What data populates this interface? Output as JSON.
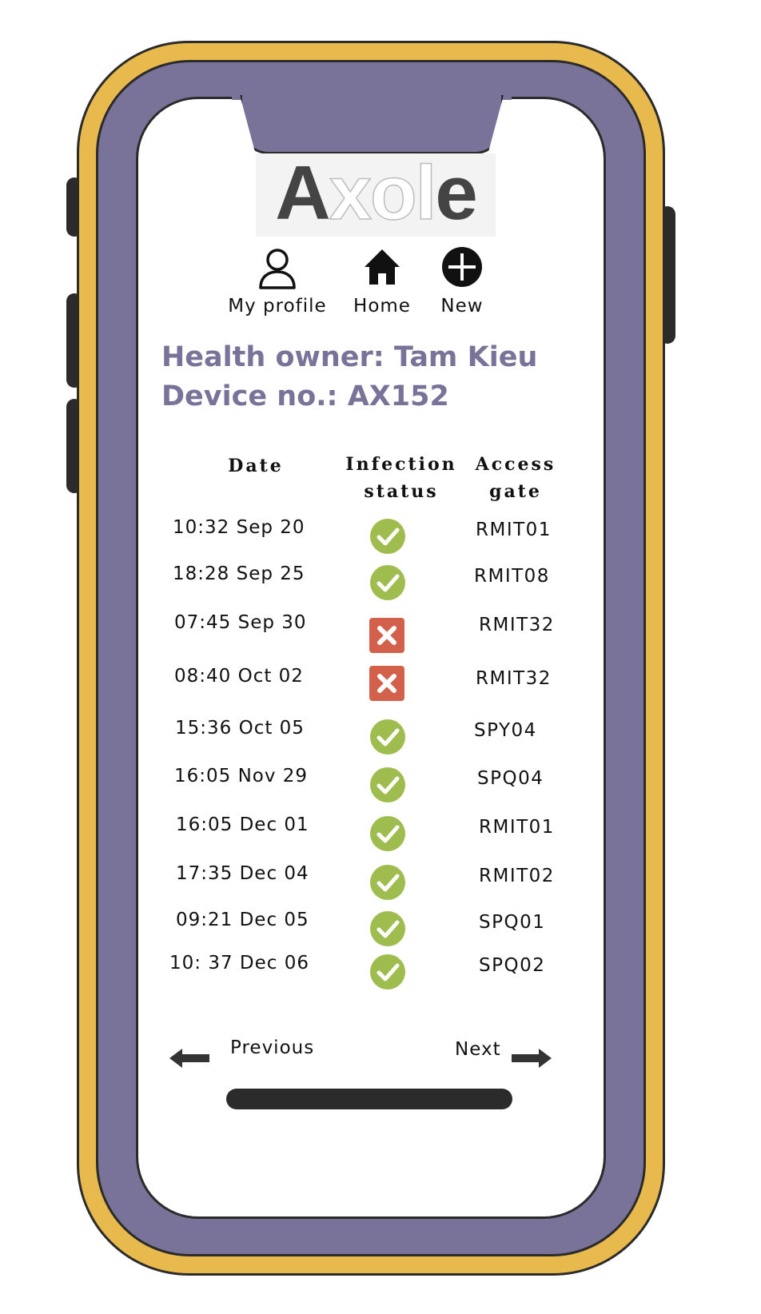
{
  "app": {
    "logo_solid_1": "A",
    "logo_hollow": "xol",
    "logo_solid_2": "e"
  },
  "nav": [
    {
      "label": "My profile",
      "icon": "user-icon"
    },
    {
      "label": "Home",
      "icon": "home-icon"
    },
    {
      "label": "New",
      "icon": "plus-circle-icon"
    }
  ],
  "owner": {
    "line1": "Health owner: Tam Kieu",
    "line2": "Device no.: AX152"
  },
  "table": {
    "headers": {
      "date": "Date",
      "status_1": "Infection",
      "status_2": "status",
      "gate_1": "Access",
      "gate_2": "gate"
    },
    "rows": [
      {
        "date": "10:32 Sep 20",
        "status": "ok",
        "gate": "RMIT01"
      },
      {
        "date": "18:28 Sep 25",
        "status": "ok",
        "gate": "RMIT08"
      },
      {
        "date": "07:45 Sep 30",
        "status": "bad",
        "gate": "RMIT32"
      },
      {
        "date": "08:40 Oct 02",
        "status": "bad",
        "gate": "RMIT32"
      },
      {
        "date": "15:36 Oct 05",
        "status": "ok",
        "gate": "SPY04"
      },
      {
        "date": "16:05 Nov 29",
        "status": "ok",
        "gate": "SPQ04"
      },
      {
        "date": "16:05 Dec 01",
        "status": "ok",
        "gate": "RMIT01"
      },
      {
        "date": "17:35 Dec 04",
        "status": "ok",
        "gate": "RMIT02"
      },
      {
        "date": "09:21 Dec 05",
        "status": "ok",
        "gate": "SPQ01"
      },
      {
        "date": "10: 37 Dec 06",
        "status": "ok",
        "gate": "SPQ02"
      }
    ]
  },
  "pager": {
    "previous": "Previous",
    "next": "Next"
  },
  "colors": {
    "accent": "#7a7399",
    "frame": "#e8b94c",
    "ok": "#9fbd4e",
    "bad": "#d2604b"
  }
}
